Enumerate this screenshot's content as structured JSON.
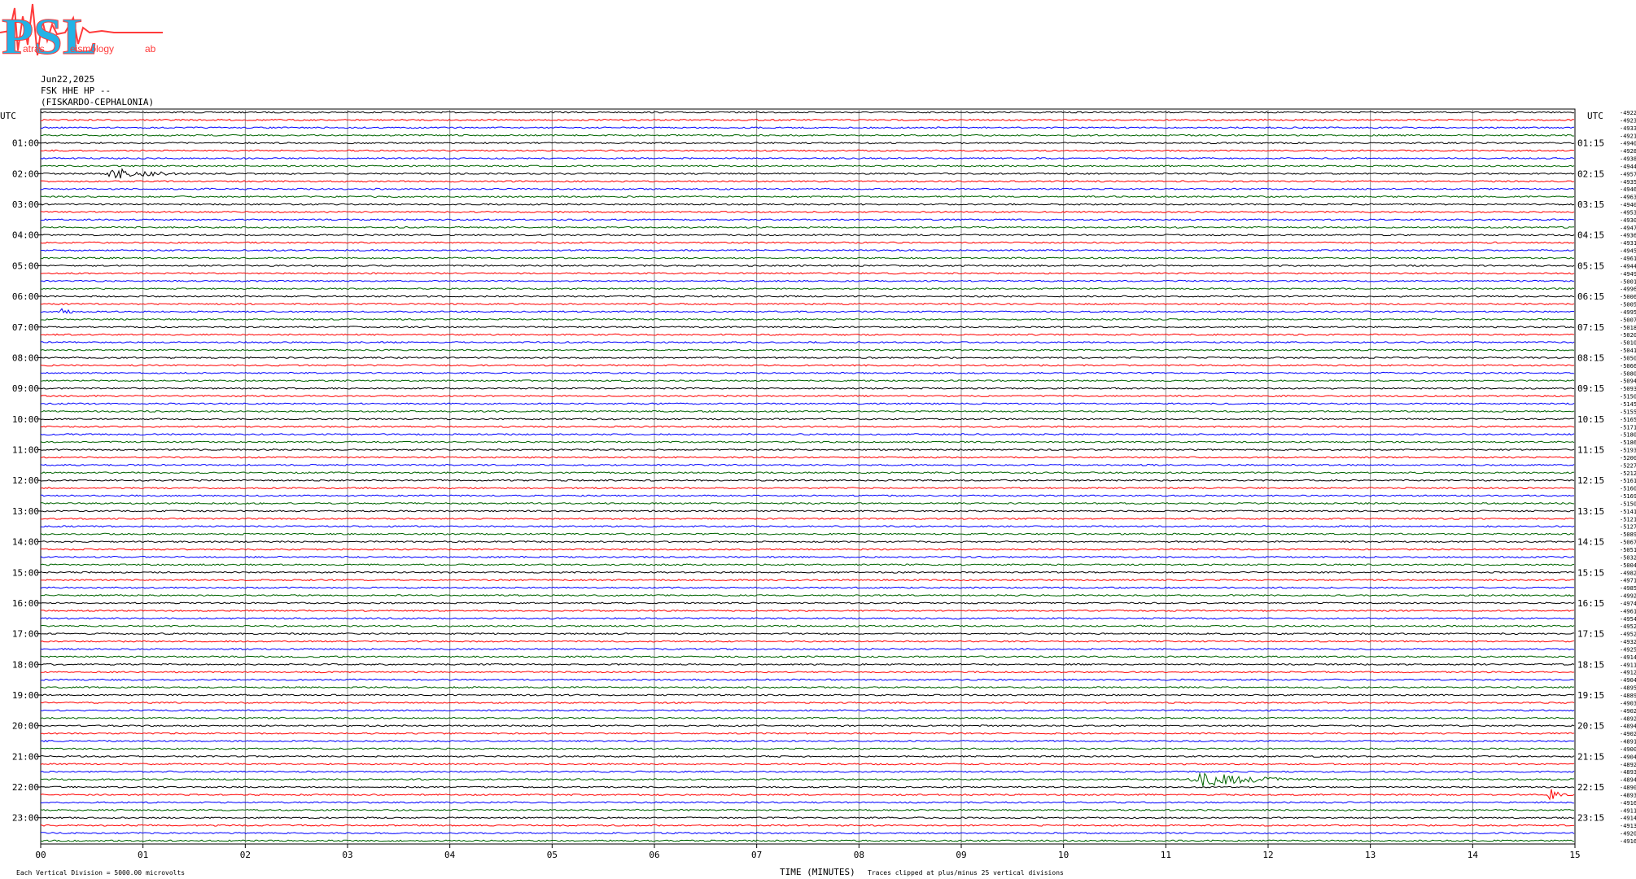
{
  "logo": {
    "text": "PSL",
    "subtext_1": "atras",
    "subtext_2": "eismology",
    "subtext_3": "ab",
    "colors": {
      "letters": "#22b3e6",
      "outline": "#ff3b3b"
    }
  },
  "header": {
    "date": "Jun22,2025",
    "station": "FSK HHE HP --",
    "location": "(FISKARDO-CEPHALONIA)"
  },
  "chart_data": {
    "type": "line",
    "title": "",
    "xlabel": "TIME (MINUTES)",
    "ylabel": "UTC",
    "right_axis_label": "UTC",
    "x_ticks": [
      "00",
      "01",
      "02",
      "03",
      "04",
      "05",
      "06",
      "07",
      "08",
      "09",
      "10",
      "11",
      "12",
      "13",
      "14",
      "15"
    ],
    "xlim": [
      0,
      15
    ],
    "left_hour_labels": [
      "01:00",
      "02:00",
      "03:00",
      "04:00",
      "05:00",
      "06:00",
      "07:00",
      "08:00",
      "09:00",
      "10:00",
      "11:00",
      "12:00",
      "13:00",
      "14:00",
      "15:00",
      "16:00",
      "17:00",
      "18:00",
      "19:00",
      "20:00",
      "21:00",
      "22:00",
      "23:00"
    ],
    "right_hour_labels": [
      "01:15",
      "02:15",
      "03:15",
      "04:15",
      "05:15",
      "06:15",
      "07:15",
      "08:15",
      "09:15",
      "10:15",
      "11:15",
      "12:15",
      "13:15",
      "14:15",
      "15:15",
      "16:15",
      "17:15",
      "18:15",
      "19:15",
      "20:15",
      "21:15",
      "22:15",
      "23:15"
    ],
    "trace_offsets": [
      "-4922",
      "-4923",
      "-4933",
      "-4921",
      "-4940",
      "-4928",
      "-4938",
      "-4944",
      "-4957",
      "-4935",
      "-4946",
      "-4963",
      "-4940",
      "-4953",
      "-4930",
      "-4947",
      "-4936",
      "-4931",
      "-4945",
      "-4961",
      "-4944",
      "-4949",
      "-5001",
      "-4996",
      "-5006",
      "-5005",
      "-4995",
      "-5007",
      "-5018",
      "-5020",
      "-5010",
      "-5041",
      "-5050",
      "-5066",
      "-5080",
      "-5094",
      "-5093",
      "-5150",
      "-5145",
      "-5155",
      "-5165",
      "-5171",
      "-5180",
      "-5186",
      "-5193",
      "-5200",
      "-5227",
      "-5212",
      "-5161",
      "-5160",
      "-5169",
      "-5150",
      "-5141",
      "-5121",
      "-5127",
      "-5089",
      "-5067",
      "-5051",
      "-5032",
      "-5004",
      "-4982",
      "-4971",
      "-4985",
      "-4992",
      "-4974",
      "-4961",
      "-4954",
      "-4952",
      "-4952",
      "-4932",
      "-4925",
      "-4914",
      "-4911",
      "-4912",
      "-4904",
      "-4895",
      "-4889",
      "-4903",
      "-4902",
      "-4892",
      "-4894",
      "-4902",
      "-4891",
      "-4900",
      "-4904",
      "-4892",
      "-4893",
      "-4894",
      "-4890",
      "-4893",
      "-4916",
      "-4911",
      "-4914",
      "-4913",
      "-4920",
      "-4916"
    ],
    "trace_colors": [
      "#000000",
      "#ff0000",
      "#0000ff",
      "#006400"
    ],
    "events": [
      {
        "trace": 8,
        "time_min": 0.6,
        "duration_min": 1.2,
        "amplitude": 7,
        "color": "#000000"
      },
      {
        "trace": 26,
        "time_min": 0.15,
        "duration_min": 0.45,
        "amplitude": 4,
        "color": "#0000ff"
      },
      {
        "trace": 87,
        "time_min": 11.2,
        "duration_min": 1.6,
        "amplitude": 9,
        "color": "#006400"
      },
      {
        "trace": 89,
        "time_min": 14.72,
        "duration_min": 0.3,
        "amplitude": 10,
        "color": "#ff0000"
      }
    ],
    "footer_left": "Each Vertical Division = 5000.00 microvolts",
    "footer_right": "Traces clipped at plus/minus 25 vertical divisions",
    "grid": true,
    "legend": "none"
  }
}
